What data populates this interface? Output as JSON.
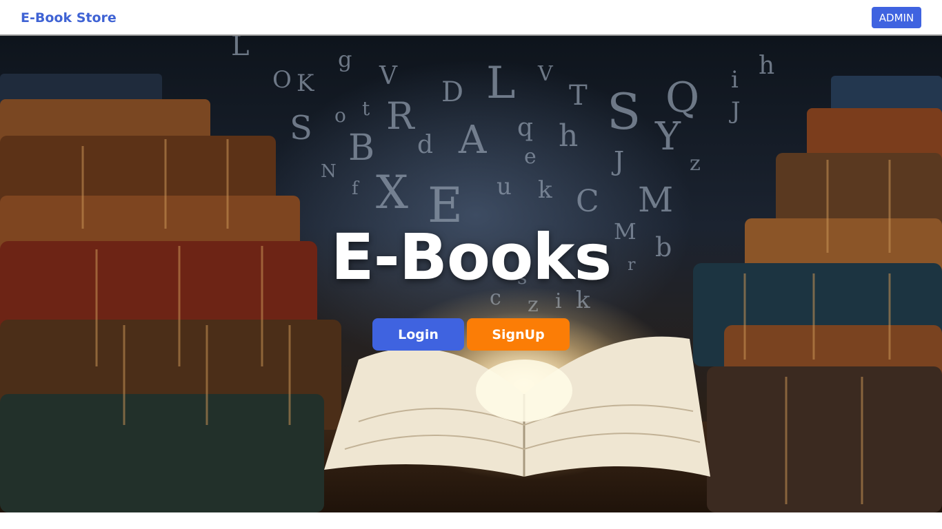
{
  "navbar": {
    "brand": "E-Book Store",
    "admin_label": "ADMIN"
  },
  "hero": {
    "title": "E-Books",
    "login_label": "Login",
    "signup_label": "SignUp",
    "background_image": "library books with floating letters and open glowing book"
  },
  "colors": {
    "brand": "#3f63d4",
    "primary_button": "#3f63e0",
    "secondary_button": "#fb7d06",
    "hero_title": "#ffffff"
  }
}
